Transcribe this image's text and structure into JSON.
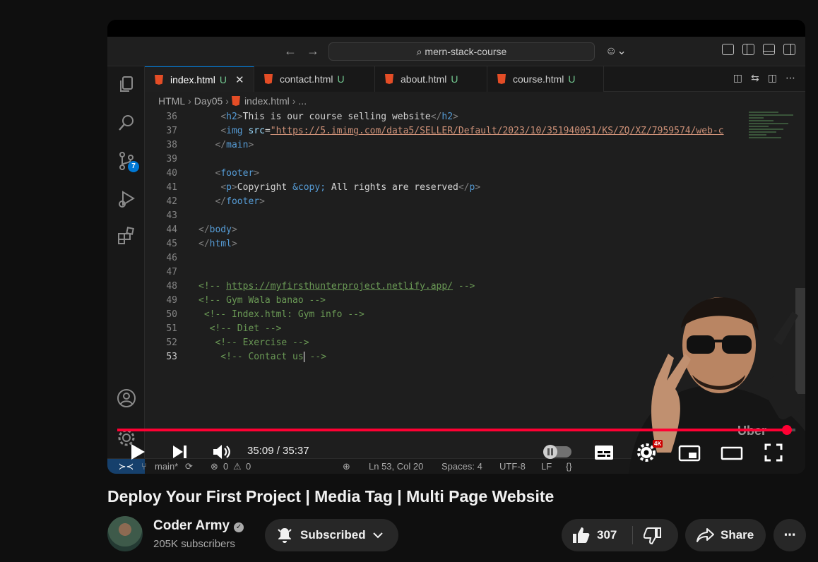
{
  "vscode": {
    "command_center": "mern-stack-course",
    "tabs": [
      {
        "label": "index.html",
        "status": "U",
        "active": true
      },
      {
        "label": "contact.html",
        "status": "U",
        "active": false
      },
      {
        "label": "about.html",
        "status": "U",
        "active": false
      },
      {
        "label": "course.html",
        "status": "U",
        "active": false
      }
    ],
    "breadcrumb": [
      "HTML",
      "Day05",
      "index.html",
      "..."
    ],
    "source_control_badge": "7",
    "code_lines": [
      {
        "n": "36",
        "text": "        <h2>This is our course selling website</h2>"
      },
      {
        "n": "37",
        "text": "        <img src=\"https://5.imimg.com/data5/SELLER/Default/2023/10/351940051/KS/ZQ/XZ/7959574/web-c"
      },
      {
        "n": "38",
        "text": "      </main>"
      },
      {
        "n": "39",
        "text": ""
      },
      {
        "n": "40",
        "text": "      <footer>"
      },
      {
        "n": "41",
        "text": "        <p>Copyright &copy; All rights are reserved</p>"
      },
      {
        "n": "42",
        "text": "      </footer>"
      },
      {
        "n": "43",
        "text": ""
      },
      {
        "n": "44",
        "text": "</body>"
      },
      {
        "n": "45",
        "text": "</html>"
      },
      {
        "n": "46",
        "text": ""
      },
      {
        "n": "47",
        "text": ""
      },
      {
        "n": "48",
        "text": "<!-- https://myfirsthunterproject.netlify.app/ -->"
      },
      {
        "n": "49",
        "text": "<!-- Gym Wala banao -->"
      },
      {
        "n": "50",
        "text": " <!-- Index.html: Gym info -->"
      },
      {
        "n": "51",
        "text": "  <!-- Diet -->"
      },
      {
        "n": "52",
        "text": "   <!-- Exercise -->"
      },
      {
        "n": "53",
        "text": "    <!-- Contact us -->"
      }
    ],
    "status": {
      "branch": "main*",
      "errors": "0",
      "warnings": "0",
      "position": "Ln 53, Col 20",
      "spaces": "Spaces: 4",
      "encoding": "UTF-8",
      "eol": "LF",
      "language_icon": "{}"
    }
  },
  "player": {
    "current_time": "35:09",
    "duration": "35:37",
    "time_display": "35:09 / 35:37",
    "progress_fraction": 0.987,
    "quality_badge": "4K",
    "watermark": "Uber"
  },
  "video": {
    "title": "Deploy Your First Project | Media Tag | Multi Page Website",
    "channel_name": "Coder Army",
    "subscribers": "205K subscribers",
    "subscribe_label": "Subscribed",
    "like_count": "307",
    "share_label": "Share"
  },
  "colors": {
    "progress": "#ff0033",
    "vscode_accent": "#0078d4",
    "untracked": "#73c991"
  }
}
